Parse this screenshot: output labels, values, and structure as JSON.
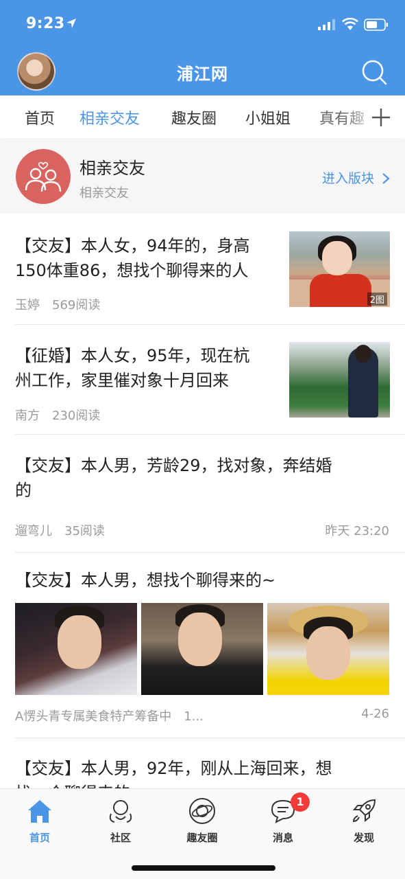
{
  "status_bar": {
    "time": "9:23"
  },
  "header": {
    "title": "浦江网"
  },
  "tabs": [
    {
      "label": "首页",
      "active": false
    },
    {
      "label": "相亲交友",
      "active": true
    },
    {
      "label": "趣友圈",
      "active": false
    },
    {
      "label": "小姐姐",
      "active": false
    },
    {
      "label": "真有趣",
      "active": false
    }
  ],
  "forum": {
    "title": "相亲交友",
    "subtitle": "相亲交友",
    "enter_label": "进入版块"
  },
  "posts": [
    {
      "title_line1": "【交友】本人女，94年的，身高",
      "title_line2": "150体重86，想找个聊得来的人",
      "author": "玉婷",
      "views": "569阅读",
      "image_badge": "2图"
    },
    {
      "title_line1": "【征婚】本人女，95年，现在杭",
      "title_line2": "州工作，家里催对象十月回来",
      "author": "南方",
      "views": "230阅读"
    },
    {
      "title_line1": "【交友】本人男，芳龄29，找对象，奔结婚",
      "title_line2": "的",
      "author": "遛弯儿",
      "views": "35阅读",
      "time": "昨天 23:20"
    },
    {
      "title_line1": "【交友】本人男，想找个聊得来的~",
      "author": "A愣头青专属美食特产筹备中　1...",
      "time": "4-26"
    },
    {
      "title_line1": "【交友】本人男，92年，刚从上海回来，想",
      "title_line2": "找一个聊得来的"
    }
  ],
  "tabbar": [
    {
      "label": "首页",
      "icon": "home-icon",
      "active": true
    },
    {
      "label": "社区",
      "icon": "community-icon",
      "active": false
    },
    {
      "label": "趣友圈",
      "icon": "planet-icon",
      "active": false
    },
    {
      "label": "消息",
      "icon": "message-icon",
      "active": false,
      "badge": "1"
    },
    {
      "label": "发现",
      "icon": "rocket-icon",
      "active": false
    }
  ],
  "colors": {
    "primary": "#4a95e5",
    "badge_red": "#f23b36",
    "forum_icon": "#d9635f"
  }
}
